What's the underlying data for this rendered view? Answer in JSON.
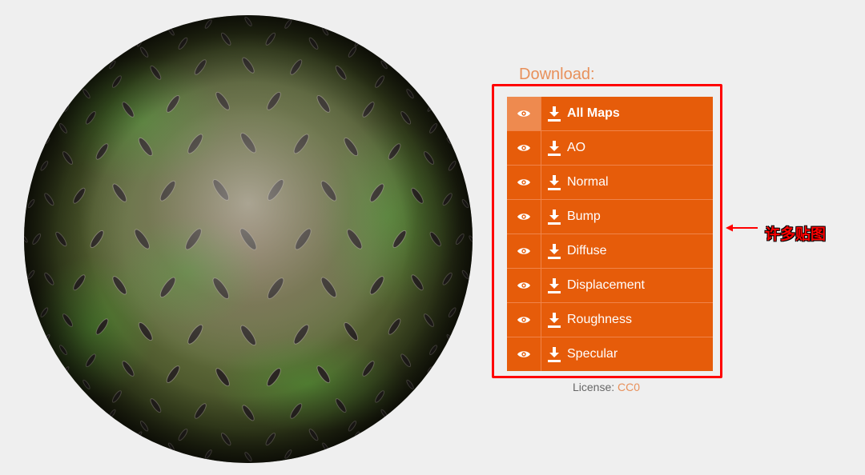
{
  "download": {
    "title": "Download:",
    "maps": [
      {
        "label": "All Maps",
        "highlight": true
      },
      {
        "label": "AO"
      },
      {
        "label": "Normal"
      },
      {
        "label": "Bump"
      },
      {
        "label": "Diffuse"
      },
      {
        "label": "Displacement"
      },
      {
        "label": "Roughness"
      },
      {
        "label": "Specular"
      }
    ]
  },
  "license": {
    "label": "License:",
    "value": "CC0"
  },
  "annotation": {
    "text": "许多贴图"
  },
  "icons": {
    "preview": "eye-icon",
    "download": "download-icon",
    "pointer": "arrow-left-icon"
  },
  "colors": {
    "accent": "#e65c0a",
    "accent_light": "#ee8a4f",
    "title": "#e8905a",
    "frame": "#ff0000",
    "background": "#efefef"
  }
}
